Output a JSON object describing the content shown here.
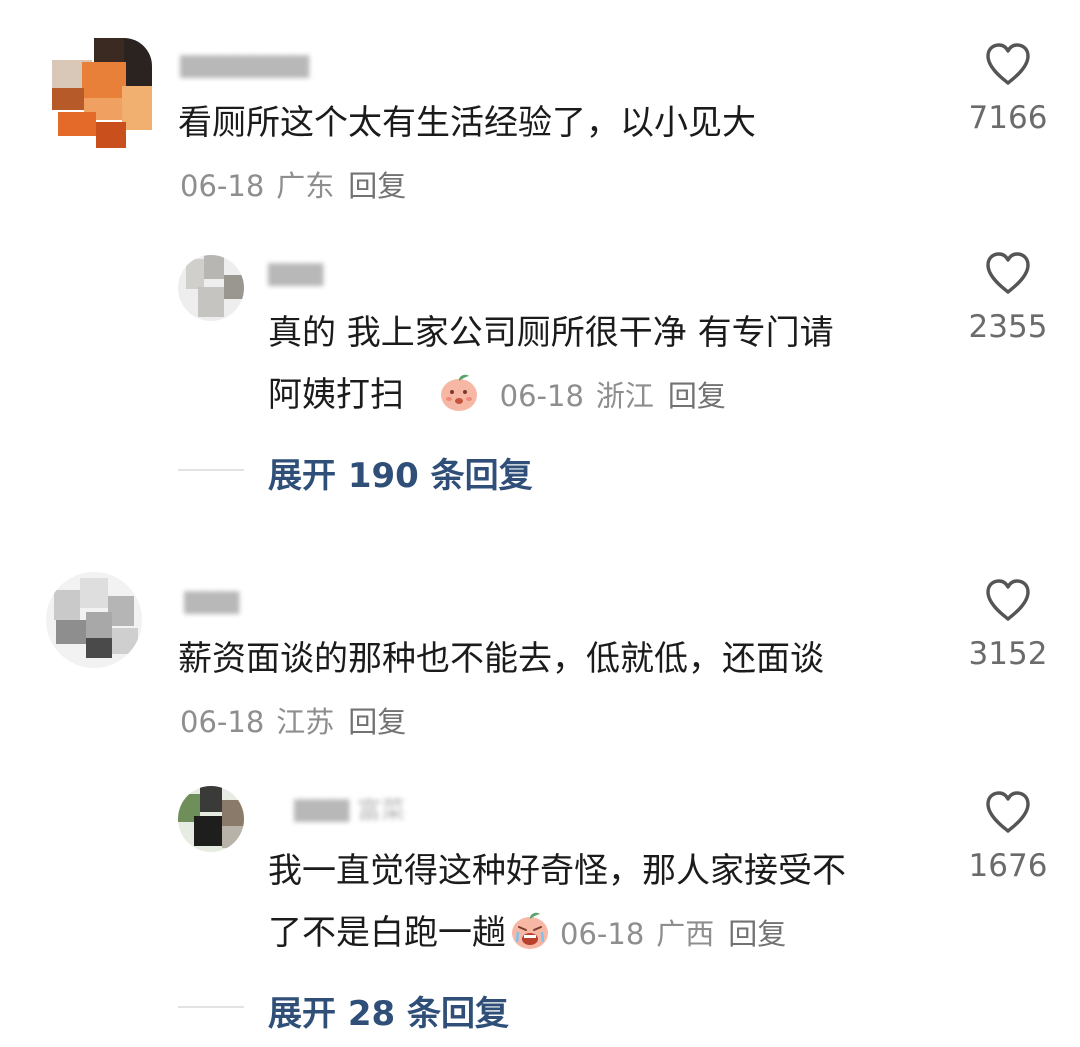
{
  "comments": [
    {
      "username": "▇▇▇▇▇▇▇",
      "text": "看厕所这个太有生活经验了，以小见大",
      "date": "06-18",
      "location": "广东",
      "reply_label": "回复",
      "likes": "7166",
      "reply": {
        "username": "▇▇▇",
        "text_line1": "真的  我上家公司厕所很干净 有专门请",
        "text_line2": "阿姨打扫",
        "emoji": "smiling-peach-emoji",
        "date": "06-18",
        "location": "浙江",
        "reply_label": "回复",
        "likes": "2355"
      },
      "expand_label": "展开 190 条回复"
    },
    {
      "username": "▇▇▇",
      "text": "薪资面谈的那种也不能去，低就低，还面谈",
      "date": "06-18",
      "location": "江苏",
      "reply_label": "回复",
      "likes": "3152",
      "reply": {
        "username": "▇▇▇ 富菜",
        "text_line1": "我一直觉得这种好奇怪，那人家接受不",
        "text_line2": "了不是白跑一趟",
        "emoji": "crying-peach-emoji",
        "date": "06-18",
        "location": "广西",
        "reply_label": "回复",
        "likes": "1676"
      },
      "expand_label": "展开 28 条回复"
    }
  ],
  "colors": {
    "text": "#1b1b1b",
    "meta": "#8e8e8e",
    "expand": "#2f4f79",
    "heart": "#555555"
  }
}
